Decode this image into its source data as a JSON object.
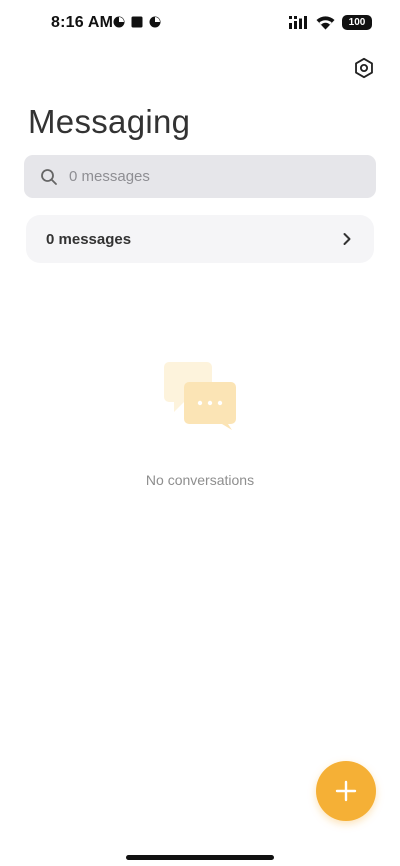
{
  "status_bar": {
    "time": "8:16 AM",
    "battery": "100",
    "icons": [
      "notification-icon",
      "stop-icon",
      "notification-icon",
      "signal-icon",
      "wifi-icon",
      "battery-icon"
    ]
  },
  "header": {
    "title": "Messaging",
    "settings_icon": "settings-icon"
  },
  "search": {
    "placeholder": "0 messages"
  },
  "messages_card": {
    "label": "0 messages"
  },
  "empty_state": {
    "icon": "chat-bubbles-icon",
    "text": "No conversations"
  },
  "fab": {
    "icon": "plus-icon"
  },
  "colors": {
    "accent": "#f5b036",
    "search_bg": "#e6e6ea",
    "card_bg": "#f5f5f7"
  }
}
